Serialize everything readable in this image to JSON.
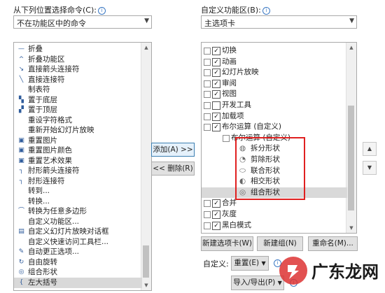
{
  "left": {
    "label": "从下列位置选择命令(C):",
    "dropdown_value": "不在功能区中的命令",
    "items": [
      {
        "label": "折叠",
        "icon": "minus-icon"
      },
      {
        "label": "折叠功能区",
        "icon": "caret-up-icon"
      },
      {
        "label": "直接箭头连接符",
        "icon": "arrow-connector-icon"
      },
      {
        "label": "直接连接符",
        "icon": "line-connector-icon"
      },
      {
        "label": "制表符",
        "icon": ""
      },
      {
        "label": "置于底层",
        "icon": "send-to-back-icon"
      },
      {
        "label": "置于顶层",
        "icon": "bring-to-front-icon"
      },
      {
        "label": "重设字符格式",
        "icon": ""
      },
      {
        "label": "重新开始幻灯片放映",
        "icon": ""
      },
      {
        "label": "重置图片",
        "icon": "reset-picture-icon"
      },
      {
        "label": "重置图片颜色",
        "icon": "reset-color-icon"
      },
      {
        "label": "重置艺术效果",
        "icon": "reset-effects-icon"
      },
      {
        "label": "肘形箭头连接符",
        "icon": "elbow-arrow-icon"
      },
      {
        "label": "肘形连接符",
        "icon": "elbow-connector-icon"
      },
      {
        "label": "转到...",
        "icon": ""
      },
      {
        "label": "转换...",
        "icon": ""
      },
      {
        "label": "转换为任意多边形",
        "icon": "freeform-icon"
      },
      {
        "label": "自定义功能区...",
        "icon": ""
      },
      {
        "label": "自定义幻灯片放映对话框",
        "icon": "custom-show-icon"
      },
      {
        "label": "自定义快速访问工具栏...",
        "icon": ""
      },
      {
        "label": "自动更正选项...",
        "icon": "autocorrect-icon"
      },
      {
        "label": "自由旋转",
        "icon": "rotate-icon"
      },
      {
        "label": "组合形状",
        "icon": "combine-shapes-icon"
      },
      {
        "label": "左大括号",
        "icon": "left-brace-icon"
      }
    ]
  },
  "middle": {
    "add_button": "添加(A) >>",
    "remove_button": "<< 删除(R)"
  },
  "right": {
    "label": "自定义功能区(B):",
    "dropdown_value": "主选项卡",
    "tree": [
      {
        "label": "切换",
        "level": 0,
        "expander": "+",
        "checked": true
      },
      {
        "label": "动画",
        "level": 0,
        "expander": "+",
        "checked": true
      },
      {
        "label": "幻灯片放映",
        "level": 0,
        "expander": "+",
        "checked": true
      },
      {
        "label": "审阅",
        "level": 0,
        "expander": "+",
        "checked": true
      },
      {
        "label": "视图",
        "level": 0,
        "expander": "+",
        "checked": true
      },
      {
        "label": "开发工具",
        "level": 0,
        "expander": "+",
        "checked": false
      },
      {
        "label": "加载项",
        "level": 0,
        "expander": "+",
        "checked": true
      },
      {
        "label": "布尔运算 (自定义)",
        "level": 0,
        "expander": "−",
        "checked": true
      },
      {
        "label": "布尔运算 (自定义)",
        "level": 1,
        "expander": "−"
      },
      {
        "label": "拆分形状",
        "level": 2,
        "icon": "fragment-shape-icon"
      },
      {
        "label": "剪除形状",
        "level": 2,
        "icon": "subtract-shape-icon"
      },
      {
        "label": "联合形状",
        "level": 2,
        "icon": "union-shape-icon"
      },
      {
        "label": "相交形状",
        "level": 2,
        "icon": "intersect-shape-icon"
      },
      {
        "label": "组合形状",
        "level": 2,
        "icon": "combine-shape-icon",
        "selected": true
      },
      {
        "label": "合并",
        "level": 0,
        "expander": "+",
        "checked": true
      },
      {
        "label": "灰度",
        "level": 0,
        "expander": "+",
        "checked": true
      },
      {
        "label": "黑白模式",
        "level": 0,
        "expander": "+",
        "checked": true
      }
    ],
    "new_tab_button": "新建选项卡(W)",
    "new_group_button": "新建组(N)",
    "rename_button": "重命名(M)...",
    "customize_label": "自定义:",
    "reset_button": "重置(E)",
    "import_export_button": "导入/导出(P)"
  },
  "watermark": "广东龙网",
  "colors": {
    "highlight": "#e02020",
    "accent": "#3a78c3"
  }
}
